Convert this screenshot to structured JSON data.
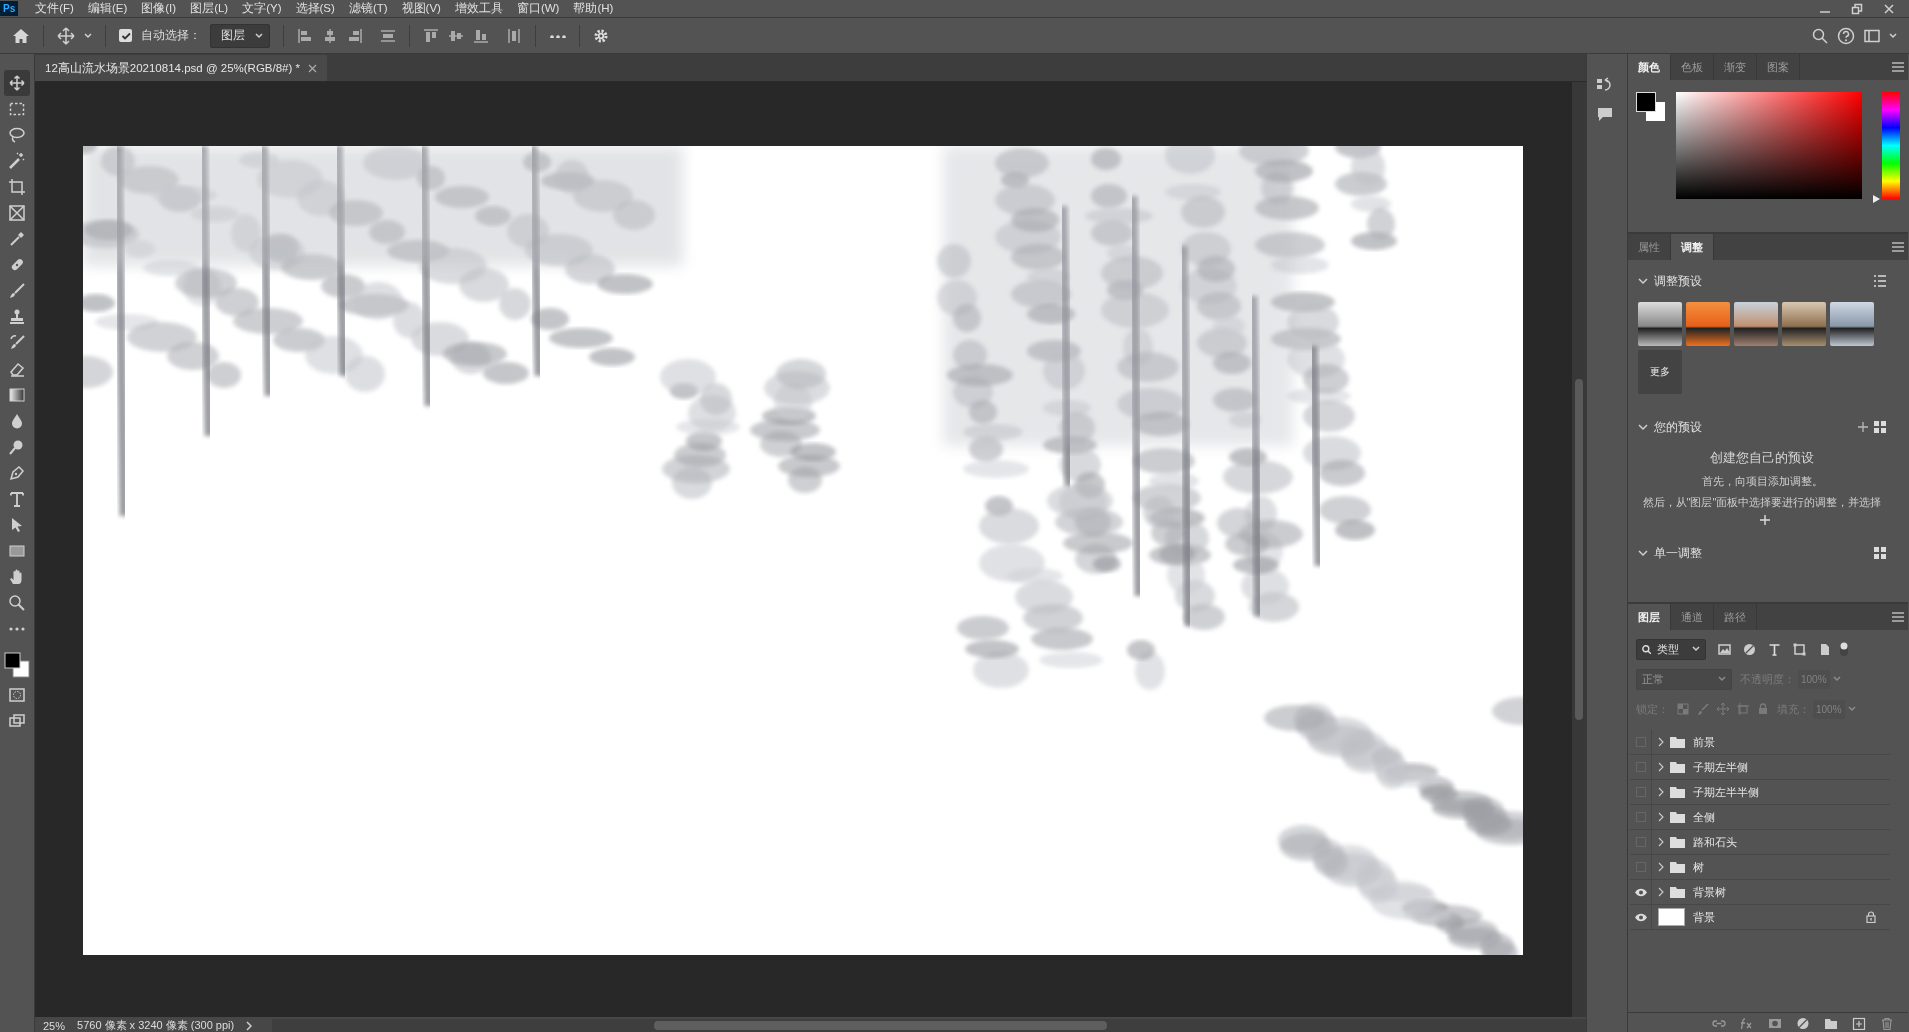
{
  "app": {
    "logo": "Ps",
    "menus": [
      "文件(F)",
      "编辑(E)",
      "图像(I)",
      "图层(L)",
      "文字(Y)",
      "选择(S)",
      "滤镜(T)",
      "视图(V)",
      "增效工具",
      "窗口(W)",
      "帮助(H)"
    ]
  },
  "options_bar": {
    "auto_select": {
      "label": "自动选择：",
      "checked": true
    },
    "target": {
      "value": "图层"
    }
  },
  "document": {
    "tab": {
      "title": "12高山流水场景20210814.psd @ 25%(RGB/8#) *"
    }
  },
  "tools": [
    {
      "kind": "move",
      "selected": true
    },
    {
      "kind": "marquee",
      "selected": false
    },
    {
      "kind": "lasso",
      "selected": false
    },
    {
      "kind": "wand",
      "selected": false
    },
    {
      "kind": "crop",
      "selected": false
    },
    {
      "kind": "frame",
      "selected": false
    },
    {
      "kind": "eyedropper",
      "selected": false
    },
    {
      "kind": "healing",
      "selected": false
    },
    {
      "kind": "brush",
      "selected": false
    },
    {
      "kind": "stamp",
      "selected": false
    },
    {
      "kind": "history",
      "selected": false
    },
    {
      "kind": "eraser",
      "selected": false
    },
    {
      "kind": "gradient",
      "selected": false
    },
    {
      "kind": "blur",
      "selected": false
    },
    {
      "kind": "dodge",
      "selected": false
    },
    {
      "kind": "pen",
      "selected": false
    },
    {
      "kind": "type",
      "selected": false
    },
    {
      "kind": "select",
      "selected": false
    },
    {
      "kind": "rectangle",
      "selected": false
    },
    {
      "kind": "hand",
      "selected": false
    },
    {
      "kind": "zoom",
      "selected": false
    },
    {
      "kind": "more",
      "selected": false
    }
  ],
  "color_panel": {
    "hue": {
      "level": 0
    },
    "tabs": [
      {
        "label": "颜色",
        "selected": true
      },
      {
        "label": "色板",
        "selected": false
      },
      {
        "label": "渐变",
        "selected": false
      },
      {
        "label": "图案",
        "selected": false
      }
    ]
  },
  "adjustments_panel": {
    "tabs": [
      {
        "label": "属性",
        "selected": false
      },
      {
        "label": "调整",
        "selected": true
      }
    ],
    "presets": {
      "title": "调整预设",
      "expanded": true,
      "more_button": "更多"
    },
    "your_presets": {
      "title": "您的预设",
      "expanded": true,
      "heading": "创建您自己的预设",
      "line_1": "首先，向项目添加调整。",
      "line_2": "然后，从\"图层\"面板中选择要进行的调整，并选择"
    },
    "single": {
      "title": "单一调整",
      "expanded": true
    }
  },
  "layers_panel": {
    "tabs": [
      {
        "label": "图层",
        "selected": true
      },
      {
        "label": "通道",
        "selected": false
      },
      {
        "label": "路径",
        "selected": false
      }
    ],
    "filter": {
      "value": "类型"
    },
    "blend_mode": {
      "value": "正常",
      "disabled": true
    },
    "opacity": {
      "label": "不透明度：",
      "value": "100%",
      "disabled": true
    },
    "lock_label": "锁定：",
    "fill": {
      "label": "填充：",
      "value": "100%",
      "disabled": true
    },
    "layers": [
      {
        "name": "前景",
        "kind": "group",
        "visible": false,
        "locked": false
      },
      {
        "name": "子期左半侧",
        "kind": "group",
        "visible": false,
        "locked": false
      },
      {
        "name": "子期左半半侧",
        "kind": "group",
        "visible": false,
        "locked": false
      },
      {
        "name": "全侧",
        "kind": "group",
        "visible": false,
        "locked": false
      },
      {
        "name": "路和石头",
        "kind": "group",
        "visible": false,
        "locked": false
      },
      {
        "name": "树",
        "kind": "group",
        "visible": false,
        "locked": false
      },
      {
        "name": "背景树",
        "kind": "group",
        "visible": true,
        "locked": false
      },
      {
        "name": "背景",
        "kind": "pixel",
        "visible": true,
        "locked": true
      }
    ]
  },
  "status_bar": {
    "zoom": "25%",
    "info": "5760 像素 x 3240 像素 (300 ppi)"
  }
}
